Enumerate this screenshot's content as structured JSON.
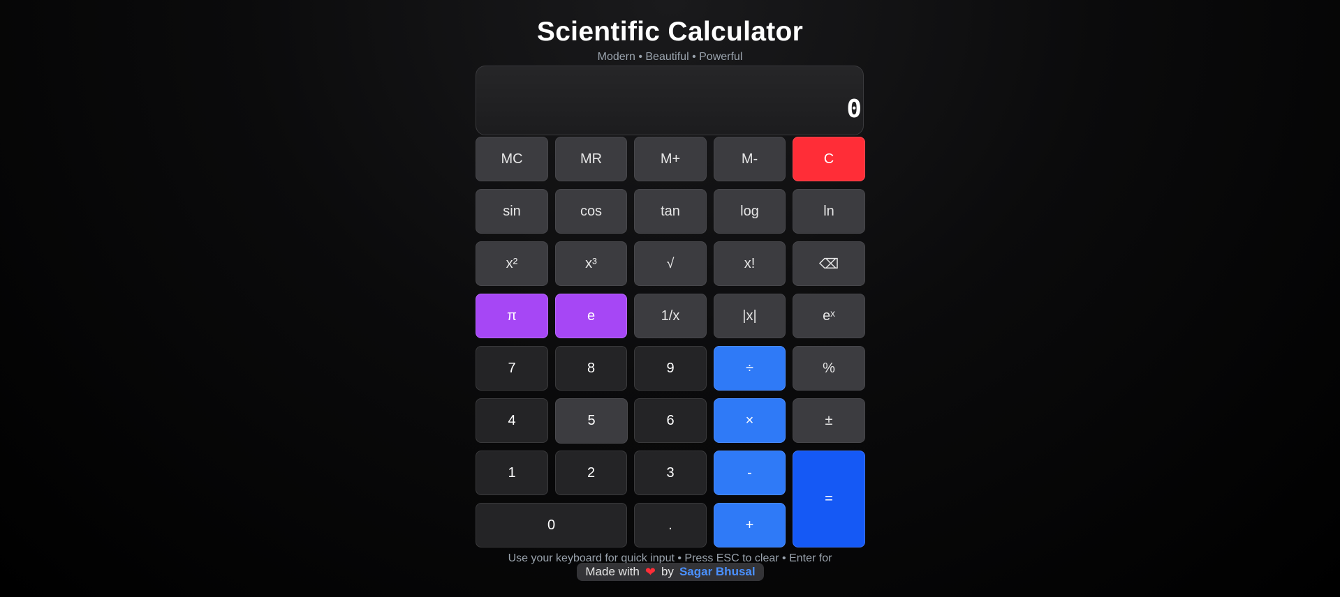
{
  "header": {
    "title": "Scientific Calculator",
    "subtitle": "Modern • Beautiful • Powerful"
  },
  "display": {
    "value": "0"
  },
  "buttons": {
    "mc": "MC",
    "mr": "MR",
    "mplus": "M+",
    "mminus": "M-",
    "clear": "C",
    "sin": "sin",
    "cos": "cos",
    "tan": "tan",
    "log": "log",
    "ln": "ln",
    "square": "x²",
    "cube": "x³",
    "sqrt": "√",
    "factorial": "x!",
    "backspace": "⌫",
    "pi": "π",
    "e": "e",
    "reciprocal": "1/x",
    "abs": "|x|",
    "exp": "eˣ",
    "seven": "7",
    "eight": "8",
    "nine": "9",
    "divide": "÷",
    "percent": "%",
    "four": "4",
    "five": "5",
    "six": "6",
    "multiply": "×",
    "plusminus": "±",
    "one": "1",
    "two": "2",
    "three": "3",
    "subtract": "-",
    "equals": "=",
    "zero": "0",
    "decimal": ".",
    "add": "+"
  },
  "footer": {
    "hint": "Use your keyboard for quick input • Press ESC to clear • Enter for",
    "made_with": "Made with",
    "heart": "❤",
    "by": "by",
    "author": "Sagar Bhusal"
  },
  "colors": {
    "clear": "#ff2d37",
    "constant": "#a647f5",
    "operator": "#2f7af7",
    "equals": "#1559f5",
    "author_link": "#4a90ff"
  }
}
